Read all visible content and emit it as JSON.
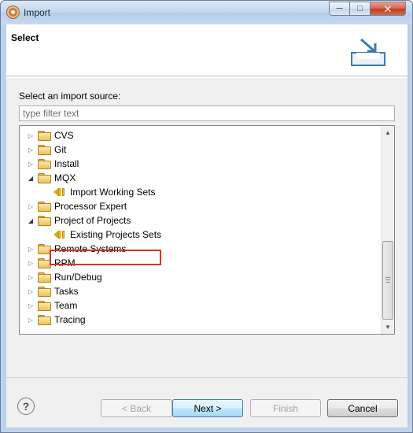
{
  "window": {
    "title": "Import"
  },
  "header": {
    "title": "Select"
  },
  "source": {
    "prompt": "Select an import source:",
    "filter_placeholder": "type filter text"
  },
  "tree": {
    "items": [
      {
        "label": "CVS",
        "type": "folder",
        "expanded": false,
        "level": 0
      },
      {
        "label": "Git",
        "type": "folder",
        "expanded": false,
        "level": 0
      },
      {
        "label": "Install",
        "type": "folder",
        "expanded": false,
        "level": 0
      },
      {
        "label": "MQX",
        "type": "folder",
        "expanded": true,
        "level": 0
      },
      {
        "label": "Import Working Sets",
        "type": "wizard",
        "level": 1
      },
      {
        "label": "Processor Expert",
        "type": "folder",
        "expanded": false,
        "level": 0
      },
      {
        "label": "Project of Projects",
        "type": "folder",
        "expanded": true,
        "level": 0
      },
      {
        "label": "Existing Projects Sets",
        "type": "wizard",
        "level": 1,
        "selected": true
      },
      {
        "label": "Remote Systems",
        "type": "folder",
        "expanded": false,
        "level": 0
      },
      {
        "label": "RPM",
        "type": "folder",
        "expanded": false,
        "level": 0
      },
      {
        "label": "Run/Debug",
        "type": "folder",
        "expanded": false,
        "level": 0
      },
      {
        "label": "Tasks",
        "type": "folder",
        "expanded": false,
        "level": 0
      },
      {
        "label": "Team",
        "type": "folder",
        "expanded": false,
        "level": 0
      },
      {
        "label": "Tracing",
        "type": "folder",
        "expanded": false,
        "level": 0
      }
    ]
  },
  "buttons": {
    "help": "?",
    "back": "< Back",
    "next": "Next >",
    "finish": "Finish",
    "cancel": "Cancel"
  },
  "colors": {
    "highlight_border": "#d9302b",
    "default_button": "#3c7fb1"
  }
}
